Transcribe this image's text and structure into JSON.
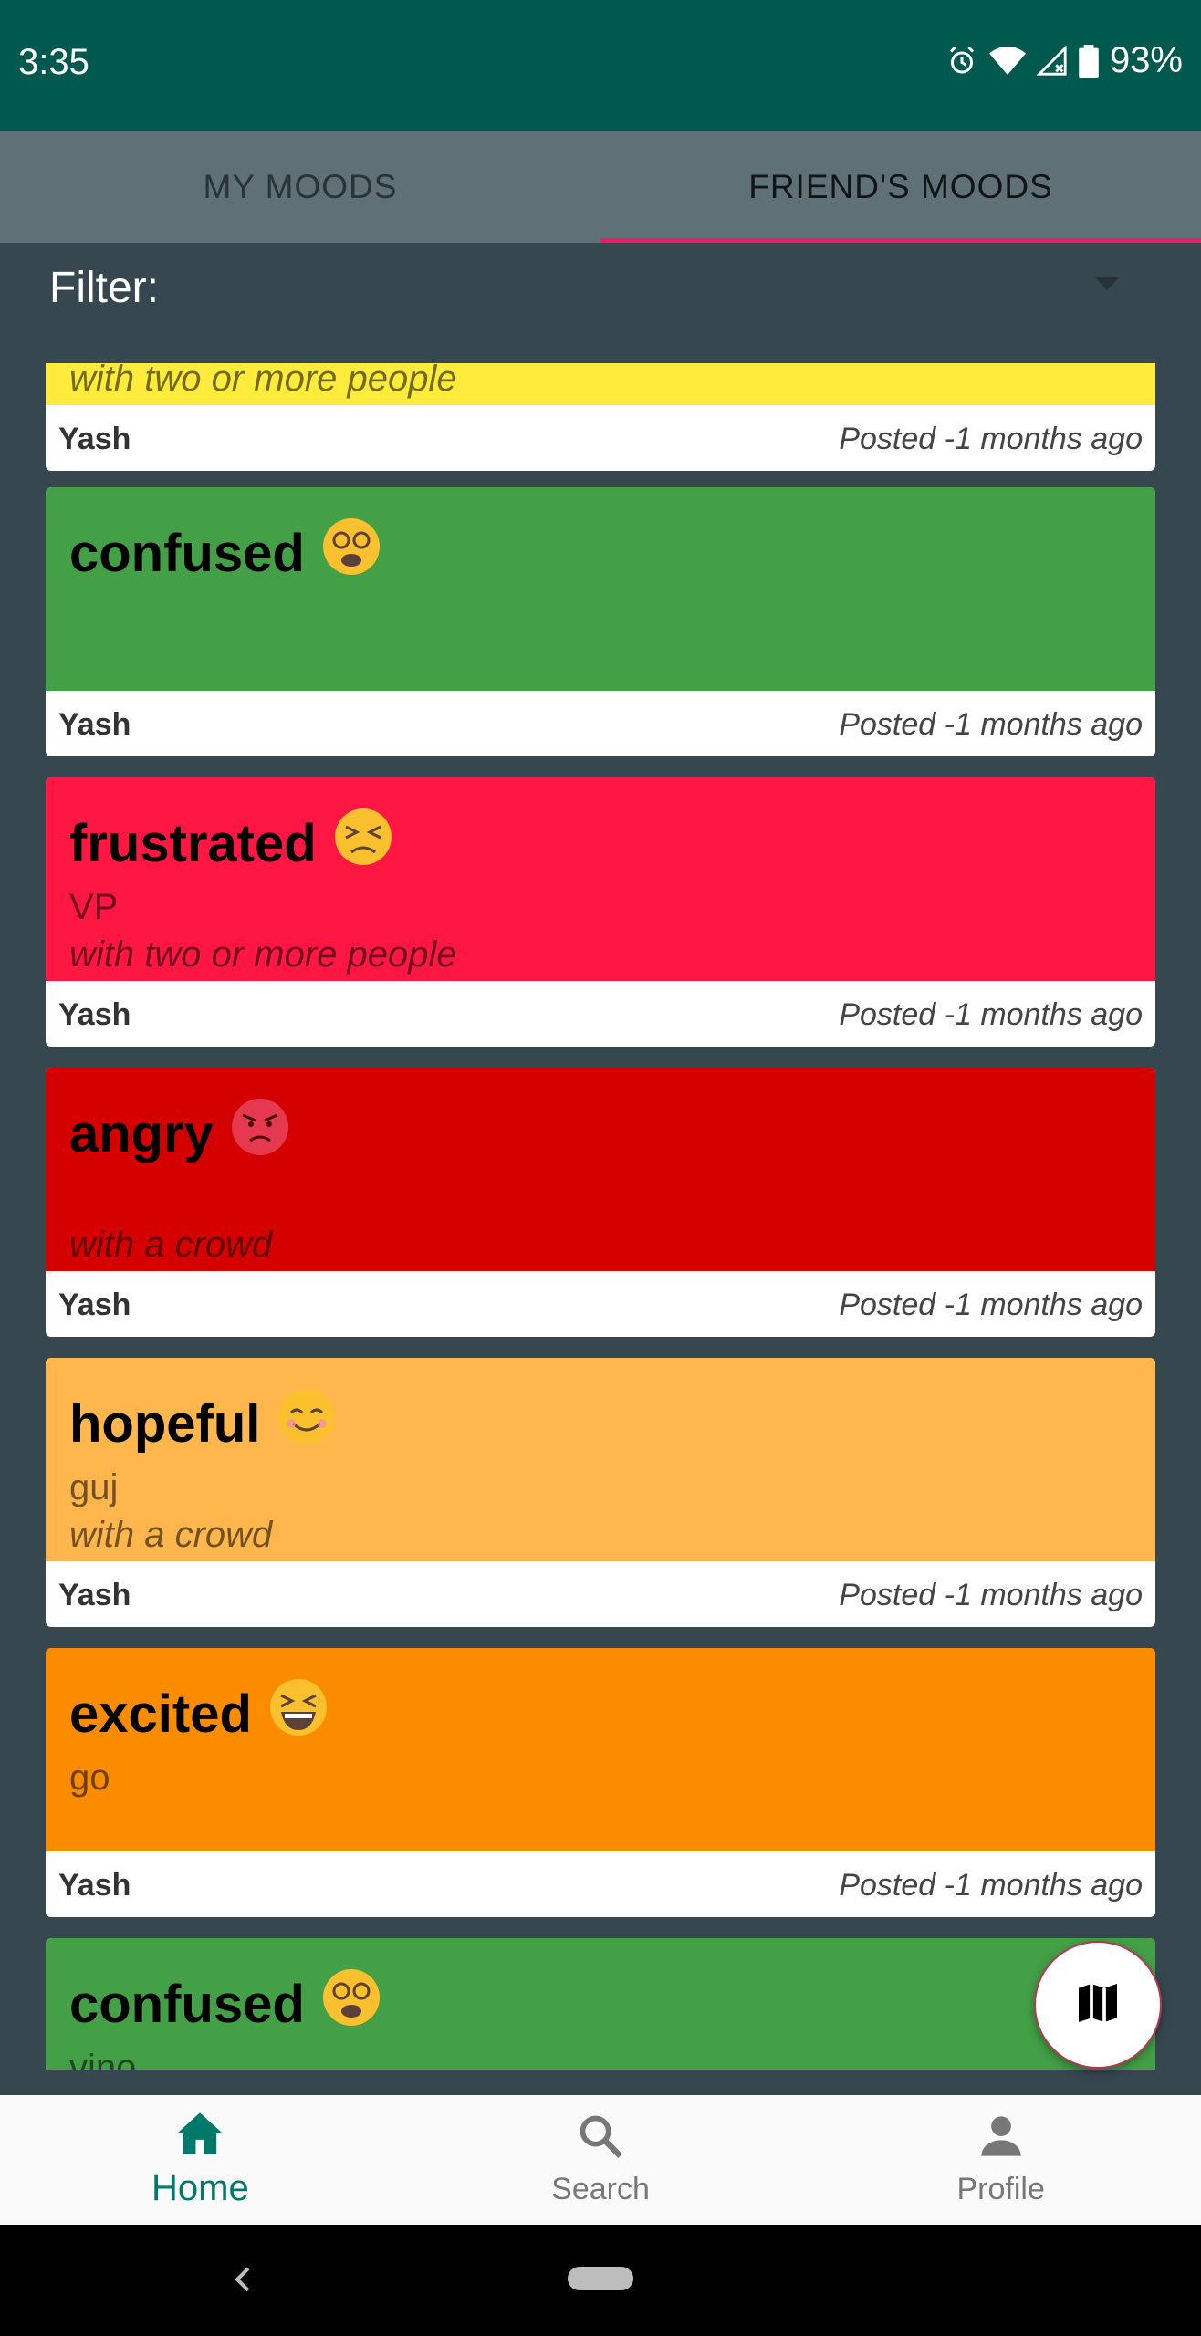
{
  "status": {
    "time": "3:35",
    "battery": "93%",
    "icons": [
      "alarm-icon",
      "wifi-icon",
      "signal-icon",
      "battery-icon"
    ]
  },
  "tabs": [
    {
      "label": "MY MOODS",
      "active": false
    },
    {
      "label": "FRIEND'S MOODS",
      "active": true
    }
  ],
  "filter": {
    "label": "Filter:"
  },
  "colors": {
    "accent": "#e91e63",
    "primary": "#00594e",
    "background": "#37474f",
    "happy": "#ffeb3b",
    "confused": "#43a047",
    "frustrated": "#ff1744",
    "angry": "#d50000",
    "hopeful": "#ffb74d",
    "excited": "#fb8c00"
  },
  "moods": [
    {
      "title": "",
      "emoji": "",
      "reason": "",
      "social": "with two or more people",
      "user": "Yash",
      "time": "Posted -1 months ago",
      "color": "#ffeb3b"
    },
    {
      "title": "confused",
      "emoji": "😵",
      "reason": "",
      "social": "",
      "user": "Yash",
      "time": "Posted -1 months ago",
      "color": "#43a047"
    },
    {
      "title": "frustrated",
      "emoji": "😣",
      "reason": "VP",
      "social": "with two or more people",
      "user": "Yash",
      "time": "Posted -1 months ago",
      "color": "#ff1744"
    },
    {
      "title": "angry",
      "emoji": "😠",
      "reason": "",
      "social": "with a crowd",
      "user": "Yash",
      "time": "Posted -1 months ago",
      "color": "#d50000"
    },
    {
      "title": "hopeful",
      "emoji": "😊",
      "reason": "guj",
      "social": "with a crowd",
      "user": "Yash",
      "time": "Posted -1 months ago",
      "color": "#ffb74d"
    },
    {
      "title": "excited",
      "emoji": "😆",
      "reason": "go",
      "social": "",
      "user": "Yash",
      "time": "Posted -1 months ago",
      "color": "#fb8c00"
    },
    {
      "title": "confused",
      "emoji": "😵",
      "reason": "vino",
      "social": "",
      "user": "",
      "time": "",
      "color": "#43a047"
    }
  ],
  "fab": {
    "icon": "map-icon"
  },
  "bottom_nav": [
    {
      "label": "Home",
      "icon": "home-icon",
      "active": true
    },
    {
      "label": "Search",
      "icon": "search-icon",
      "active": false
    },
    {
      "label": "Profile",
      "icon": "person-icon",
      "active": false
    }
  ]
}
